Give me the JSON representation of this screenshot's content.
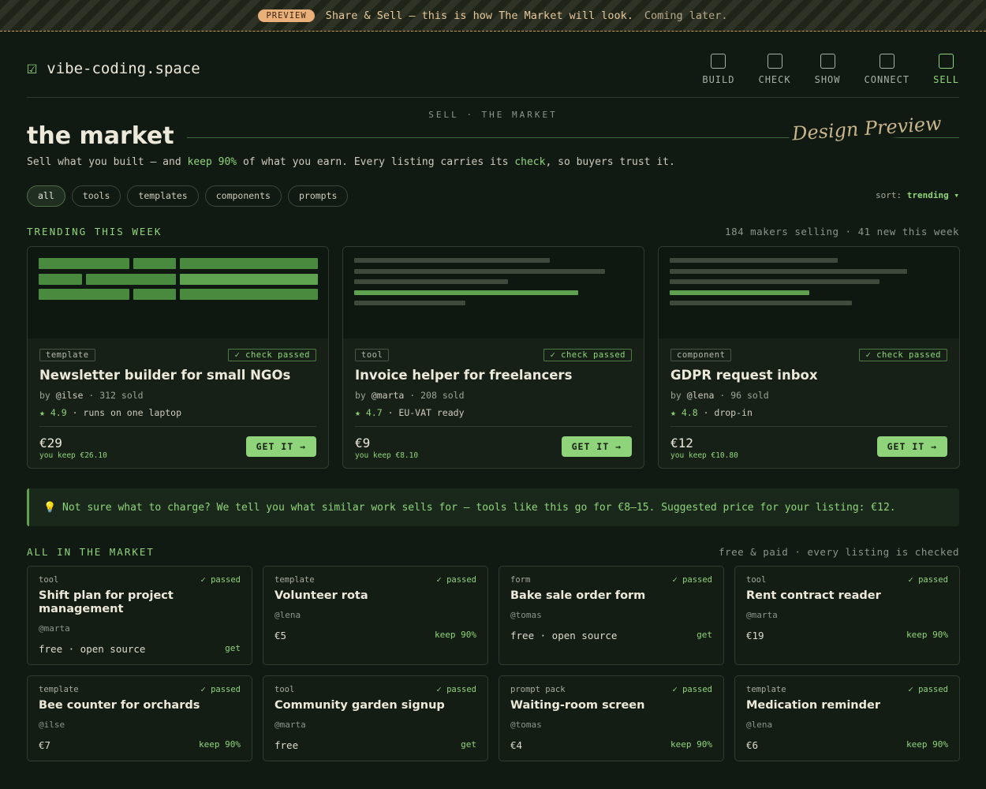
{
  "banner": {
    "pill": "PREVIEW",
    "text": "Share & Sell — this is how The Market will look.",
    "muted": "Coming later."
  },
  "header": {
    "logo_icon": "checkbox-check-icon",
    "brand": "vibe-coding.space",
    "nav": [
      {
        "label": "BUILD",
        "active": false
      },
      {
        "label": "CHECK",
        "active": false
      },
      {
        "label": "SHOW",
        "active": false
      },
      {
        "label": "CONNECT",
        "active": false
      },
      {
        "label": "SELL",
        "active": true
      }
    ]
  },
  "page": {
    "crumb": "SELL · THE MARKET",
    "title": "the market",
    "stamp": "Design Preview",
    "subtitle": {
      "a": "Sell what you built — and ",
      "b": "keep 90%",
      "c": " of what you earn. Every listing carries its ",
      "d": "check",
      "e": ", so buyers trust it."
    }
  },
  "filters": {
    "chips": [
      "all",
      "tools",
      "templates",
      "components",
      "prompts"
    ],
    "active": "all",
    "sort_label": "sort:",
    "sort_value": "trending ▾"
  },
  "trending": {
    "label": "TRENDING THIS WEEK",
    "meta": "184 makers selling · 41 new this week",
    "cards": [
      {
        "tag": "template",
        "badge": "✓ check passed",
        "title": "Newsletter builder for small NGOs",
        "by": "by",
        "user": "@ilse",
        "sold": "· 312 sold",
        "rating": "★ 4.9",
        "note": "·  runs on one laptop",
        "price": "€29",
        "keep": "you keep €26.10",
        "cta": "GET IT →"
      },
      {
        "tag": "tool",
        "badge": "✓ check passed",
        "title": "Invoice helper for freelancers",
        "by": "by",
        "user": "@marta",
        "sold": "· 208 sold",
        "rating": "★ 4.7",
        "note": "·  EU-VAT ready",
        "price": "€9",
        "keep": "you keep €8.10",
        "cta": "GET IT →"
      },
      {
        "tag": "component",
        "badge": "✓ check passed",
        "title": "GDPR request inbox",
        "by": "by",
        "user": "@lena",
        "sold": "· 96 sold",
        "rating": "★ 4.8",
        "note": "·  drop-in",
        "price": "€12",
        "keep": "you keep €10.80",
        "cta": "GET IT →"
      }
    ]
  },
  "tip": {
    "icon": "lightbulb-icon",
    "text": "💡 Not sure what to charge? We tell you what similar work sells for — tools like this go for €8–15. Suggested price for your listing: €12."
  },
  "all": {
    "label": "ALL IN THE MARKET",
    "meta": "free & paid · every listing is checked",
    "items": [
      {
        "cat": "tool",
        "passed": "✓ passed",
        "title": "Shift plan for project management",
        "user": "@marta",
        "price": "free · open source",
        "action": "get"
      },
      {
        "cat": "template",
        "passed": "✓ passed",
        "title": "Volunteer rota",
        "user": "@lena",
        "price": "€5",
        "action": "keep 90%"
      },
      {
        "cat": "form",
        "passed": "✓ passed",
        "title": "Bake sale order form",
        "user": "@tomas",
        "price": "free · open source",
        "action": "get"
      },
      {
        "cat": "tool",
        "passed": "✓ passed",
        "title": "Rent contract reader",
        "user": "@marta",
        "price": "€19",
        "action": "keep 90%"
      },
      {
        "cat": "template",
        "passed": "✓ passed",
        "title": "Bee counter for orchards",
        "user": "@ilse",
        "price": "€7",
        "action": "keep 90%"
      },
      {
        "cat": "tool",
        "passed": "✓ passed",
        "title": "Community garden signup",
        "user": "@marta",
        "price": "free",
        "action": "get"
      },
      {
        "cat": "prompt pack",
        "passed": "✓ passed",
        "title": "Waiting-room screen",
        "user": "@tomas",
        "price": "€4",
        "action": "keep 90%"
      },
      {
        "cat": "template",
        "passed": "✓ passed",
        "title": "Medication reminder",
        "user": "@lena",
        "price": "€6",
        "action": "keep 90%"
      }
    ]
  },
  "colors": {
    "accent": "#8fd47a",
    "background": "#111a12",
    "warning": "#eab07a"
  }
}
